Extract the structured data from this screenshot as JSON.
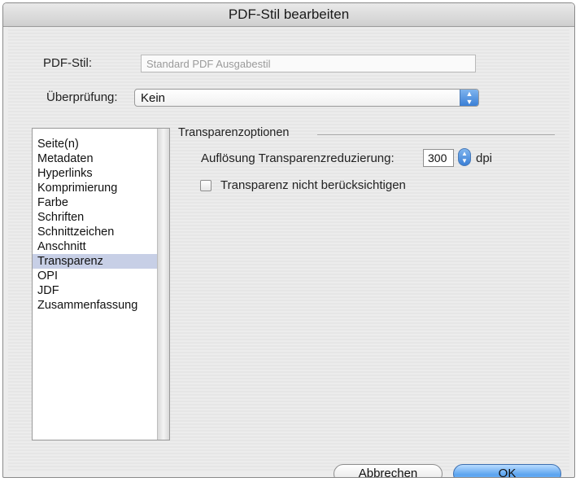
{
  "window": {
    "title": "PDF-Stil bearbeiten"
  },
  "form": {
    "style_label": "PDF-Stil:",
    "style_value": "Standard PDF Ausgabestil",
    "check_label": "Überprüfung:",
    "check_value": "Kein"
  },
  "sidebar": {
    "items": [
      {
        "label": "Seite(n)"
      },
      {
        "label": "Metadaten"
      },
      {
        "label": "Hyperlinks"
      },
      {
        "label": "Komprimierung"
      },
      {
        "label": "Farbe"
      },
      {
        "label": "Schriften"
      },
      {
        "label": "Schnittzeichen"
      },
      {
        "label": "Anschnitt"
      },
      {
        "label": "Transparenz"
      },
      {
        "label": "OPI"
      },
      {
        "label": "JDF"
      },
      {
        "label": "Zusammenfassung"
      }
    ],
    "selected": "Transparenz"
  },
  "transparency": {
    "group_title": "Transparenzoptionen",
    "resolution_label": "Auflösung Transparenzreduzierung:",
    "resolution_value": "300",
    "resolution_unit": "dpi",
    "ignore_label": "Transparenz nicht berücksichtigen",
    "ignore_checked": false
  },
  "buttons": {
    "cancel": "Abbrechen",
    "ok": "OK"
  },
  "icons": {
    "popup_arrows": "up-down-arrows-icon",
    "stepper_arrows": "stepper-arrows-icon",
    "checkbox": "checkbox-icon"
  },
  "colors": {
    "accent": "#5ba4ef",
    "selection": "#c7cfe6",
    "window_bg": "#ececec"
  }
}
